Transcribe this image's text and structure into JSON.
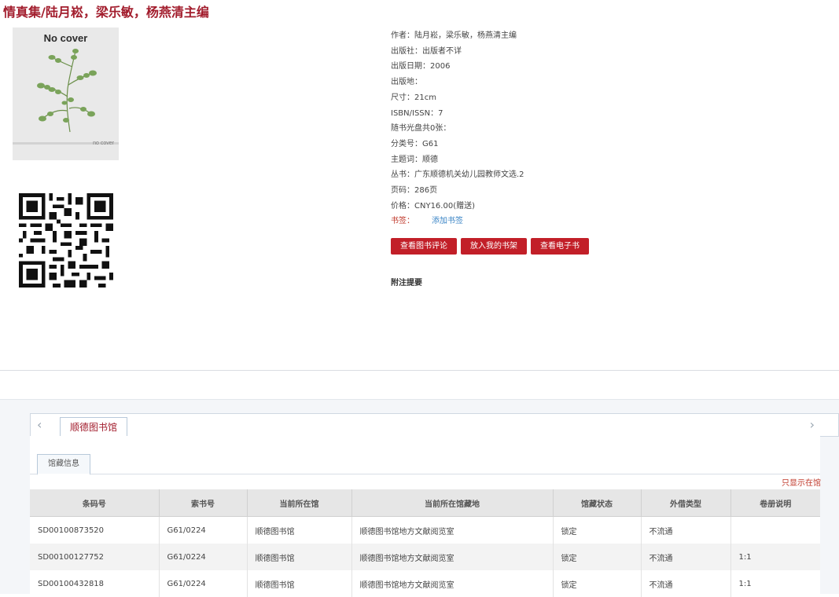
{
  "book": {
    "title": "情真集/陆月崧，梁乐敏，杨燕清主编",
    "cover": {
      "top_text": "No cover",
      "bottom_text": "no cover"
    },
    "details": [
      {
        "label": "作者：",
        "value": "陆月崧，梁乐敏，杨燕清主编"
      },
      {
        "label": "出版社：",
        "value": "出版者不详"
      },
      {
        "label": "出版日期：",
        "value": "2006"
      },
      {
        "label": "出版地：",
        "value": ""
      },
      {
        "label": "尺寸：",
        "value": "21cm"
      },
      {
        "label": "ISBN/ISSN：",
        "value": "7"
      },
      {
        "label": "随书光盘共0张：",
        "value": ""
      },
      {
        "label": "分类号：",
        "value": "G61"
      },
      {
        "label": "主题词：",
        "value": "顺德"
      },
      {
        "label": "丛书：",
        "value": "广东顺德机关幼儿园教师文选.2"
      },
      {
        "label": "页码：",
        "value": "286页"
      },
      {
        "label": "价格：",
        "value": "CNY16.00(赠送)"
      }
    ],
    "bookmark_label": "书签：",
    "bookmark_action": "添加书签"
  },
  "actions": {
    "view_reviews": "查看图书评论",
    "add_to_shelf": "放入我的书架",
    "view_ebook": "查看电子书"
  },
  "notes_heading": "附注提要",
  "library_tab": "顺德图书馆",
  "holdings_tab": "馆藏信息",
  "only_in_library_link": "只显示在馆",
  "arrows": {
    "left": "‹",
    "right": "›"
  },
  "holdings": {
    "columns": [
      "条码号",
      "索书号",
      "当前所在馆",
      "当前所在馆藏地",
      "馆藏状态",
      "外借类型",
      "卷册说明"
    ],
    "rows": [
      [
        "SD00100873520",
        "G61/0224",
        "顺德图书馆",
        "顺德图书馆地方文献阅览室",
        "锁定",
        "不流通",
        ""
      ],
      [
        "SD00100127752",
        "G61/0224",
        "顺德图书馆",
        "顺德图书馆地方文献阅览室",
        "锁定",
        "不流通",
        "1:1"
      ],
      [
        "SD00100432818",
        "G61/0224",
        "顺德图书馆",
        "顺德图书馆地方文献阅览室",
        "锁定",
        "不流通",
        "1:1"
      ]
    ]
  },
  "colors": {
    "accent": "#a21d2d",
    "button": "#c21f28",
    "link": "#3b85c6"
  }
}
